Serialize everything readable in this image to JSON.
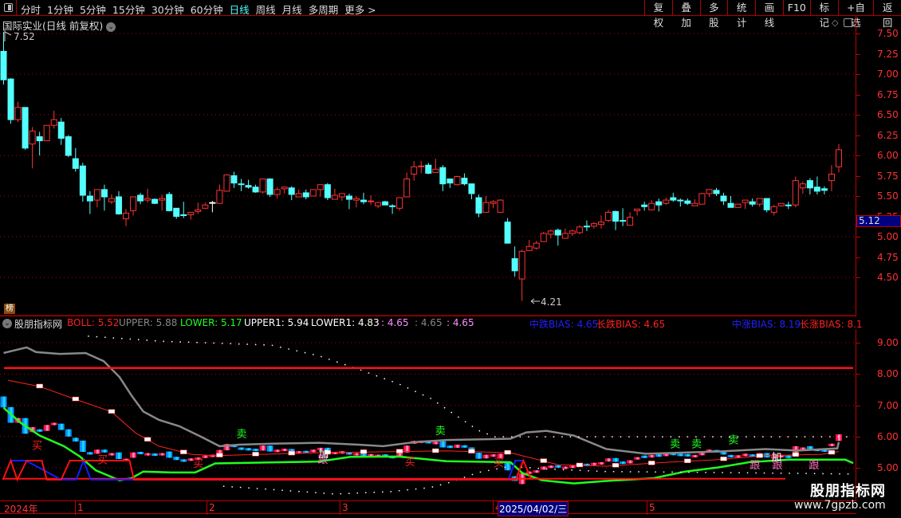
{
  "toolbar": {
    "tabs": [
      "分时",
      "1分钟",
      "5分钟",
      "15分钟",
      "30分钟",
      "60分钟",
      "日线",
      "周线",
      "月线",
      "多周期",
      "更多 >"
    ],
    "active_tab": "日线",
    "buttons": [
      "复权",
      "叠加",
      "多股",
      "统计",
      "画线",
      "F10",
      "标记",
      "+自选",
      "返回"
    ]
  },
  "main": {
    "title": "国际实业(日线 前复权)",
    "high_label": "7.52",
    "low_label": "4.21",
    "current_price": "5.12",
    "badge": "榜",
    "y_labels": [
      "7.50",
      "7.25",
      "7.00",
      "6.75",
      "6.50",
      "6.25",
      "6.00",
      "5.75",
      "5.50",
      "5.25",
      "5.00",
      "4.75",
      "4.50"
    ]
  },
  "indicator": {
    "name": "股朋指标网",
    "items": [
      {
        "t": "BOLL: 5.52",
        "c": "#ff2020"
      },
      {
        "t": "UPPER: 5.88",
        "c": "#888888"
      },
      {
        "t": "LOWER: 5.17",
        "c": "#20ff20"
      },
      {
        "t": "UPPER1: 5.94",
        "c": "#ffffff"
      },
      {
        "t": "LOWER1: 4.83",
        "c": "#ffffff"
      },
      {
        "t": ": 4.65",
        "c": "#ff90ff"
      },
      {
        "t": ": 4.65",
        "c": "#888888"
      },
      {
        "t": ": 4.65",
        "c": "#ff90ff"
      }
    ],
    "bias": [
      {
        "t": "中跌BIAS: 4.65",
        "c": "#2020ff"
      },
      {
        "t": "长跌BIAS: 4.65",
        "c": "#ff2020"
      },
      {
        "t": "中涨BIAS: 8.19",
        "c": "#2020ff"
      },
      {
        "t": "长涨BIAS: 8.1",
        "c": "#ff2020"
      }
    ],
    "y_labels": [
      "9.00",
      "8.00",
      "7.00",
      "6.00",
      "5.00"
    ]
  },
  "dates": {
    "labels": [
      "2024年",
      "1",
      "2",
      "3",
      "4",
      "5"
    ],
    "cursor_date": "2025/04/02/三"
  },
  "watermark": {
    "name": "股朋指标网",
    "url": "www.7gpzb.com"
  },
  "colors": {
    "up": "#ff3232",
    "down": "#54ffff",
    "grid": "#b00000"
  },
  "chart_data": {
    "type": "candlestick",
    "ohlc": [
      [
        7.28,
        7.52,
        6.87,
        6.93
      ],
      [
        6.94,
        6.95,
        6.39,
        6.44
      ],
      [
        6.44,
        6.66,
        6.41,
        6.59
      ],
      [
        6.59,
        6.59,
        6.07,
        6.09
      ],
      [
        6.14,
        6.35,
        5.84,
        6.3
      ],
      [
        6.23,
        6.29,
        6.0,
        6.18
      ],
      [
        6.18,
        6.37,
        6.18,
        6.37
      ],
      [
        6.37,
        6.55,
        6.33,
        6.44
      ],
      [
        6.41,
        6.46,
        6.13,
        6.21
      ],
      [
        6.23,
        6.25,
        5.98,
        6.0
      ],
      [
        5.96,
        6.09,
        5.8,
        5.84
      ],
      [
        5.87,
        5.91,
        5.43,
        5.51
      ],
      [
        5.5,
        5.56,
        5.28,
        5.44
      ],
      [
        5.45,
        5.58,
        5.36,
        5.58
      ],
      [
        5.58,
        5.64,
        5.32,
        5.49
      ],
      [
        5.43,
        5.52,
        5.4,
        5.47
      ],
      [
        5.49,
        5.56,
        5.27,
        5.28
      ],
      [
        5.22,
        5.34,
        5.13,
        5.29
      ],
      [
        5.32,
        5.49,
        5.26,
        5.49
      ],
      [
        5.51,
        5.54,
        5.4,
        5.44
      ],
      [
        5.45,
        5.59,
        5.42,
        5.47
      ],
      [
        5.46,
        5.47,
        5.4,
        5.41
      ],
      [
        5.45,
        5.52,
        5.32,
        5.47
      ],
      [
        5.52,
        5.55,
        5.31,
        5.32
      ],
      [
        5.35,
        5.35,
        5.22,
        5.25
      ],
      [
        5.27,
        5.43,
        5.23,
        5.26
      ],
      [
        5.27,
        5.3,
        5.21,
        5.3
      ],
      [
        5.31,
        5.42,
        5.28,
        5.33
      ],
      [
        5.35,
        5.42,
        5.34,
        5.39
      ],
      [
        5.42,
        5.44,
        5.3,
        5.42
      ],
      [
        5.41,
        5.64,
        5.41,
        5.57
      ],
      [
        5.56,
        5.76,
        5.56,
        5.76
      ],
      [
        5.75,
        5.8,
        5.6,
        5.66
      ],
      [
        5.65,
        5.71,
        5.56,
        5.64
      ],
      [
        5.63,
        5.7,
        5.59,
        5.61
      ],
      [
        5.61,
        5.64,
        5.54,
        5.55
      ],
      [
        5.55,
        5.71,
        5.53,
        5.71
      ],
      [
        5.71,
        5.72,
        5.49,
        5.52
      ],
      [
        5.52,
        5.61,
        5.47,
        5.58
      ],
      [
        5.59,
        5.61,
        5.53,
        5.61
      ],
      [
        5.6,
        5.62,
        5.45,
        5.52
      ],
      [
        5.49,
        5.58,
        5.49,
        5.53
      ],
      [
        5.54,
        5.58,
        5.46,
        5.49
      ],
      [
        5.5,
        5.58,
        5.5,
        5.58
      ],
      [
        5.58,
        5.64,
        5.49,
        5.64
      ],
      [
        5.64,
        5.66,
        5.45,
        5.48
      ],
      [
        5.46,
        5.59,
        5.46,
        5.51
      ],
      [
        5.49,
        5.53,
        5.44,
        5.53
      ],
      [
        5.5,
        5.53,
        5.34,
        5.46
      ],
      [
        5.45,
        5.5,
        5.36,
        5.47
      ],
      [
        5.45,
        5.54,
        5.4,
        5.43
      ],
      [
        5.43,
        5.51,
        5.39,
        5.44
      ],
      [
        5.38,
        5.42,
        5.35,
        5.42
      ],
      [
        5.43,
        5.44,
        5.39,
        5.39
      ],
      [
        5.38,
        5.4,
        5.28,
        5.37
      ],
      [
        5.35,
        5.48,
        5.32,
        5.48
      ],
      [
        5.49,
        5.79,
        5.49,
        5.71
      ],
      [
        5.77,
        5.93,
        5.69,
        5.86
      ],
      [
        5.86,
        5.93,
        5.78,
        5.87
      ],
      [
        5.88,
        5.91,
        5.77,
        5.78
      ],
      [
        5.79,
        5.96,
        5.79,
        5.83
      ],
      [
        5.85,
        5.88,
        5.56,
        5.65
      ],
      [
        5.71,
        5.71,
        5.6,
        5.66
      ],
      [
        5.64,
        5.75,
        5.63,
        5.74
      ],
      [
        5.72,
        5.78,
        5.63,
        5.65
      ],
      [
        5.65,
        5.65,
        5.46,
        5.53
      ],
      [
        5.48,
        5.52,
        5.24,
        5.29
      ],
      [
        5.3,
        5.5,
        5.3,
        5.42
      ],
      [
        5.41,
        5.45,
        5.35,
        5.43
      ],
      [
        5.3,
        5.46,
        5.3,
        5.45
      ],
      [
        5.18,
        5.23,
        4.92,
        4.92
      ],
      [
        4.73,
        4.88,
        4.51,
        4.58
      ],
      [
        4.48,
        4.84,
        4.21,
        4.82
      ],
      [
        4.83,
        4.96,
        4.83,
        4.88
      ],
      [
        4.86,
        4.95,
        4.84,
        4.92
      ],
      [
        4.94,
        5.06,
        4.94,
        5.04
      ],
      [
        5.03,
        5.09,
        4.98,
        5.07
      ],
      [
        5.08,
        5.1,
        4.89,
        5.02
      ],
      [
        4.98,
        5.1,
        4.98,
        5.04
      ],
      [
        5.04,
        5.09,
        5.01,
        5.07
      ],
      [
        5.05,
        5.14,
        5.03,
        5.12
      ],
      [
        5.13,
        5.2,
        5.07,
        5.12
      ],
      [
        5.13,
        5.18,
        5.1,
        5.16
      ],
      [
        5.15,
        5.26,
        5.1,
        5.18
      ],
      [
        5.2,
        5.33,
        5.18,
        5.3
      ],
      [
        5.31,
        5.32,
        5.08,
        5.19
      ],
      [
        5.2,
        5.35,
        5.13,
        5.19
      ],
      [
        5.14,
        5.3,
        5.14,
        5.24
      ],
      [
        5.32,
        5.34,
        5.26,
        5.34
      ],
      [
        5.39,
        5.43,
        5.32,
        5.37
      ],
      [
        5.33,
        5.45,
        5.33,
        5.41
      ],
      [
        5.43,
        5.47,
        5.31,
        5.39
      ],
      [
        5.41,
        5.48,
        5.39,
        5.45
      ],
      [
        5.48,
        5.54,
        5.43,
        5.45
      ],
      [
        5.45,
        5.47,
        5.37,
        5.44
      ],
      [
        5.44,
        5.47,
        5.39,
        5.41
      ],
      [
        5.38,
        5.46,
        5.38,
        5.41
      ],
      [
        5.4,
        5.54,
        5.4,
        5.53
      ],
      [
        5.53,
        5.58,
        5.49,
        5.58
      ],
      [
        5.57,
        5.6,
        5.5,
        5.53
      ],
      [
        5.5,
        5.54,
        5.39,
        5.44
      ],
      [
        5.41,
        5.5,
        5.36,
        5.36
      ],
      [
        5.36,
        5.4,
        5.36,
        5.4
      ],
      [
        5.42,
        5.45,
        5.34,
        5.45
      ],
      [
        5.43,
        5.47,
        5.37,
        5.4
      ],
      [
        5.4,
        5.47,
        5.37,
        5.47
      ],
      [
        5.47,
        5.47,
        5.3,
        5.33
      ],
      [
        5.3,
        5.39,
        5.26,
        5.37
      ],
      [
        5.38,
        5.41,
        5.37,
        5.41
      ],
      [
        5.39,
        5.43,
        5.34,
        5.38
      ],
      [
        5.39,
        5.74,
        5.36,
        5.69
      ],
      [
        5.6,
        5.68,
        5.53,
        5.65
      ],
      [
        5.69,
        5.72,
        5.52,
        5.6
      ],
      [
        5.61,
        5.74,
        5.52,
        5.56
      ],
      [
        5.59,
        5.62,
        5.52,
        5.57
      ],
      [
        5.69,
        5.88,
        5.56,
        5.77
      ],
      [
        5.86,
        6.14,
        5.79,
        6.07
      ]
    ],
    "main_ylim": [
      4.1,
      7.6
    ],
    "indicator_series": {
      "upper": [
        [
          0,
          8.67
        ],
        [
          3.2,
          8.85
        ],
        [
          4.5,
          8.7
        ],
        [
          7.8,
          8.64
        ],
        [
          11.4,
          8.67
        ],
        [
          13.9,
          8.41
        ],
        [
          16.1,
          7.9
        ],
        [
          17.8,
          7.3
        ],
        [
          19.4,
          6.8
        ],
        [
          21.6,
          6.53
        ],
        [
          24.4,
          6.33
        ],
        [
          27.2,
          6.02
        ],
        [
          30,
          5.69
        ],
        [
          32.7,
          5.74
        ],
        [
          37.2,
          5.77
        ],
        [
          43.8,
          5.8
        ],
        [
          49.3,
          5.74
        ],
        [
          52.7,
          5.69
        ],
        [
          57.1,
          5.82
        ],
        [
          61.5,
          5.89
        ],
        [
          70.4,
          5.93
        ],
        [
          72.6,
          6.13
        ],
        [
          75.4,
          6.18
        ],
        [
          79.2,
          6.03
        ],
        [
          83.7,
          5.6
        ],
        [
          89.2,
          5.45
        ],
        [
          99.2,
          5.52
        ],
        [
          105.8,
          5.6
        ],
        [
          110.2,
          5.55
        ],
        [
          115.8,
          5.62
        ],
        [
          116,
          5.82
        ]
      ],
      "boll": [
        [
          0.6,
          7.8
        ],
        [
          5,
          7.6
        ],
        [
          10.6,
          7.14
        ],
        [
          15,
          6.79
        ],
        [
          18.3,
          6.12
        ],
        [
          21.6,
          5.69
        ],
        [
          26.1,
          5.43
        ],
        [
          29.4,
          5.39
        ],
        [
          43.8,
          5.48
        ],
        [
          54.9,
          5.52
        ],
        [
          61.5,
          5.54
        ],
        [
          70.4,
          5.48
        ],
        [
          77,
          5.1
        ],
        [
          83.7,
          5.05
        ],
        [
          92.5,
          5.18
        ],
        [
          99.2,
          5.26
        ],
        [
          105.8,
          5.39
        ],
        [
          113.6,
          5.43
        ],
        [
          116,
          5.52
        ]
      ],
      "lower": [
        [
          0,
          6.92
        ],
        [
          2.3,
          6.45
        ],
        [
          5,
          6.03
        ],
        [
          8.4,
          5.69
        ],
        [
          10.6,
          5.36
        ],
        [
          12.8,
          4.92
        ],
        [
          16.1,
          4.6
        ],
        [
          17.8,
          4.67
        ],
        [
          19.4,
          4.88
        ],
        [
          23.3,
          4.85
        ],
        [
          26.6,
          4.85
        ],
        [
          29.4,
          5.14
        ],
        [
          43.8,
          5.2
        ],
        [
          48.2,
          5.35
        ],
        [
          54.9,
          5.36
        ],
        [
          61.5,
          5.21
        ],
        [
          70.4,
          5.18
        ],
        [
          72.0,
          4.84
        ],
        [
          74.8,
          4.6
        ],
        [
          79.2,
          4.5
        ],
        [
          83.7,
          4.58
        ],
        [
          90.3,
          4.67
        ],
        [
          94.7,
          4.88
        ],
        [
          99.2,
          5.01
        ],
        [
          103.6,
          5.18
        ],
        [
          109.1,
          5.26
        ],
        [
          116.9,
          5.26
        ],
        [
          118,
          5.15
        ]
      ],
      "upper1": [
        [
          11.7,
          9.21
        ],
        [
          21.6,
          9.05
        ],
        [
          37.2,
          8.92
        ],
        [
          43.8,
          8.58
        ],
        [
          49.3,
          8.15
        ],
        [
          54.9,
          7.68
        ],
        [
          59.3,
          7.22
        ],
        [
          63.7,
          6.54
        ],
        [
          65.9,
          6.2
        ],
        [
          68.2,
          5.99
        ],
        [
          118,
          5.99
        ]
      ],
      "lower1": [
        [
          30.5,
          4.41
        ],
        [
          38.3,
          4.29
        ],
        [
          46,
          4.16
        ],
        [
          53.8,
          4.24
        ],
        [
          59.3,
          4.37
        ],
        [
          62.1,
          4.54
        ],
        [
          65.9,
          4.85
        ],
        [
          70.4,
          5.05
        ],
        [
          74.8,
          4.97
        ],
        [
          83.7,
          4.88
        ],
        [
          99.2,
          4.85
        ],
        [
          118,
          4.8
        ]
      ],
      "bias_up_level": 8.19,
      "bias_down_level": 4.65,
      "zigzag_red": [
        [
          -0.1,
          4.62
        ],
        [
          1,
          5.23
        ],
        [
          1.9,
          4.62
        ],
        [
          3.2,
          5.23
        ],
        [
          5.3,
          5.23
        ],
        [
          6,
          4.62
        ],
        [
          8,
          4.62
        ],
        [
          9.2,
          5.23
        ],
        [
          17.5,
          5.23
        ],
        [
          18.1,
          4.62
        ],
        [
          71.1,
          4.62
        ],
        [
          72.2,
          5.23
        ],
        [
          73.3,
          4.62
        ]
      ],
      "zigzag_blue": [
        [
          1,
          5.23
        ],
        [
          3.1,
          5.23
        ],
        [
          8,
          4.62
        ],
        [
          10.1,
          4.62
        ],
        [
          11.1,
          5.23
        ],
        [
          12.1,
          4.62
        ],
        [
          13.1,
          4.62
        ],
        [
          17.7,
          4.62
        ],
        [
          70.1,
          4.62
        ],
        [
          71.1,
          5.23
        ],
        [
          72.2,
          5.23
        ]
      ]
    },
    "signals": [
      {
        "t": "买",
        "c": "#ff2020",
        "i": 4.6,
        "v": 5.6
      },
      {
        "t": "买",
        "c": "#ff2020",
        "i": 13.7,
        "v": 5.14
      },
      {
        "t": "买",
        "c": "#ff2020",
        "i": 27,
        "v": 5.02
      },
      {
        "t": "买",
        "c": "#ff2020",
        "i": 56.4,
        "v": 5.08
      },
      {
        "t": "买",
        "c": "#ff2020",
        "i": 68.7,
        "v": 5.05
      },
      {
        "t": "卖",
        "c": "#20ff20",
        "i": 33,
        "v": 5.97
      },
      {
        "t": "卖",
        "c": "#20ff20",
        "i": 60.6,
        "v": 6.07
      },
      {
        "t": "卖",
        "c": "#20ff20",
        "i": 93.2,
        "v": 5.65
      },
      {
        "t": "卖",
        "c": "#20ff20",
        "i": 96.2,
        "v": 5.65
      },
      {
        "t": "卖",
        "c": "#20ff20",
        "i": 101.3,
        "v": 5.78
      },
      {
        "t": "跟",
        "c": "#ff70c0",
        "i": 44.3,
        "v": 5.15
      },
      {
        "t": "跟",
        "c": "#ff70c0",
        "i": 104.3,
        "v": 4.97
      },
      {
        "t": "跟",
        "c": "#ff70c0",
        "i": 107.4,
        "v": 4.97
      },
      {
        "t": "跟",
        "c": "#ff70c0",
        "i": 112.5,
        "v": 4.97
      },
      {
        "t": "加",
        "c": "#ffffff",
        "i": 44.4,
        "v": 5.33
      },
      {
        "t": "加",
        "c": "#ffffff",
        "i": 107.3,
        "v": 5.23
      }
    ],
    "indicator_ylim": [
      4.05,
      9.3
    ]
  }
}
